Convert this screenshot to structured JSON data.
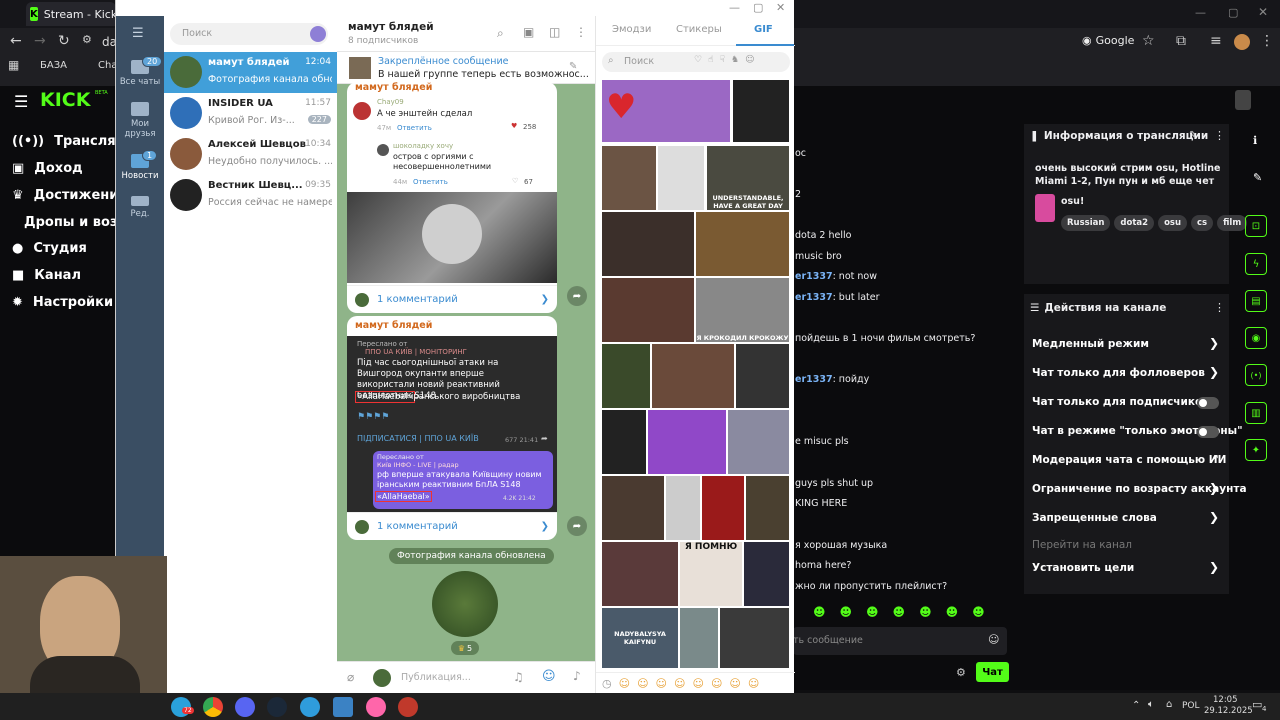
{
  "browser": {
    "tab_title": "Stream - Kick Dash",
    "address_partial": "da",
    "bookmarks": [
      "БАЗА",
      "Chat"
    ],
    "profile_btn": "Google"
  },
  "kick_nav": {
    "logo": "KICK",
    "logo_sup": "BETA",
    "items": [
      "Трансляция",
      "Доход",
      "Достижения",
      "Дропы и вознагр",
      "Студия",
      "Канал",
      "Настройки"
    ]
  },
  "tg_folders": [
    {
      "label": "Все чаты",
      "badge": "20"
    },
    {
      "label": "Мои друзья",
      "badge": ""
    },
    {
      "label": "Новости",
      "badge": "1"
    },
    {
      "label": "Ред.",
      "badge": ""
    }
  ],
  "tg_search_placeholder": "Поиск",
  "tg_chats": [
    {
      "name": "мамут блядей",
      "time": "12:04",
      "preview": "Фотография канала обновл...",
      "count": "",
      "active": true,
      "avatar": "#4a6b3a"
    },
    {
      "name": "INSIDER UA",
      "time": "11:57",
      "preview": "Кривой Рог. Из-...",
      "count": "227",
      "active": false,
      "avatar": "#2f6fb8"
    },
    {
      "name": "Алексей Шевцов",
      "time": "10:34",
      "preview": "Неудобно получилось. ...",
      "count": "",
      "active": false,
      "avatar": "#8a5a3c"
    },
    {
      "name": "Вестник Шевц...",
      "time": "09:35",
      "preview": "Россия сейчас не намерена...",
      "count": "",
      "active": false,
      "avatar": "#222"
    }
  ],
  "tg_channel": {
    "title": "мамут блядей",
    "subscribers": "8 подписчиков"
  },
  "tg_pinned": {
    "title": "Закреплённое сообщение",
    "text": "В нашей группе теперь есть возможнос..."
  },
  "tg_posts": {
    "sender": "мамут блядей",
    "comment1_user": "Chay09",
    "comment1_text": "А че энштейн сделал",
    "comment1_time": "47м",
    "reply": "Ответить",
    "comment1_likes": "258",
    "comment2_user": "шоколадку хочу",
    "comment2_text": "остров с оргиями с несовершеннолетними",
    "comment2_time": "44м",
    "comment2_likes": "67",
    "comments_btn": "1 комментарий",
    "forward_from": "Переслано от",
    "forward_src": "ППО UA КИЇВ | МОНІТОРИНГ",
    "news_text": "Під час сьогоднішньої атаки на Вишгород окупанти вперше використали новий реактивний безпілотник S148",
    "highlight": "«AllaHaebal»",
    "news_tail": " іранського виробництва",
    "subscribe": "ПІДПИСАТИСЯ | ППО UA КИЇВ",
    "inner_src": "Київ ІНФО - LIVE | радар",
    "inner_text": "рф вперше атакувала Київщину новим іранським реактивним БпЛА S148",
    "service": "Фотография канала обновлена",
    "reaction": "5",
    "meta1": "677 21:41",
    "meta2": "4.2K 21:42"
  },
  "tg_input_placeholder": "Публикация...",
  "tg_emoji": {
    "tabs": [
      "Эмодзи",
      "Стикеры",
      "GIF"
    ],
    "active_tab": "GIF",
    "search_placeholder": "Поиск",
    "gif_captions": [
      "UNDERSTANDABLE, HAVE A GREAT DAY",
      "Я КРОКОДИЛ КРОКОЖУ",
      "Я ПОМНЮ",
      "NADYBALYSYA KAIFYNU"
    ]
  },
  "stream_info": {
    "header": "Информация о трансляции",
    "title": "очень высокий стрим osu, Hotline Miami 1-2, Пун пун и мб еще чет",
    "category": "osu!",
    "tags": [
      "Russian",
      "dota2",
      "osu",
      "cs",
      "film"
    ]
  },
  "channel_actions": {
    "header": "Действия на канале",
    "items": [
      {
        "label": "Медленный режим",
        "type": "arrow"
      },
      {
        "label": "Чат только для фолловеров",
        "type": "arrow"
      },
      {
        "label": "Чат только для подписчиков",
        "type": "toggle"
      },
      {
        "label": "Чат в режиме \"только эмотиконы\"",
        "type": "toggle"
      },
      {
        "label": "Модерация чата с помощью ИИ",
        "type": "ext"
      },
      {
        "label": "Ограничение по возрасту аккаунта",
        "type": "arrow"
      },
      {
        "label": "Запрещенные слова",
        "type": "arrow"
      },
      {
        "label": "Перейти на канал",
        "type": "disabled"
      },
      {
        "label": "Установить цели",
        "type": "arrow"
      }
    ]
  },
  "chat_lines": [
    {
      "user": "",
      "text": "ос"
    },
    {
      "user": "",
      "text": "2"
    },
    {
      "user": "",
      "text": "dota 2 hello"
    },
    {
      "user": "",
      "text": "music bro"
    },
    {
      "user": "er1337",
      "text": ": not now"
    },
    {
      "user": "er1337",
      "text": ": but later"
    },
    {
      "user": "",
      "text": "пойдешь в 1 ночи фильм смотреть?"
    },
    {
      "user": "er1337",
      "text": ": пойду"
    },
    {
      "user": "",
      "text": "e misuc pls"
    },
    {
      "user": "",
      "text": "guys pls shut up"
    },
    {
      "user": "",
      "text": "KING HERE"
    },
    {
      "user": "",
      "text": "я хорошая музыка"
    },
    {
      "user": "",
      "text": "homa here?"
    },
    {
      "user": "",
      "text": "жно ли пропустить плейлист?"
    }
  ],
  "chat_input_placeholder": "ть сообщение",
  "chat_button": "Чат",
  "taskbar": {
    "lang": "POL",
    "time": "12:05",
    "date": "29.12.2025",
    "notif": "4",
    "tg_badge": "72"
  },
  "colors": {
    "kick_green": "#53fc18",
    "tg_blue": "#419fd9",
    "tg_bg": "#8fb489"
  }
}
